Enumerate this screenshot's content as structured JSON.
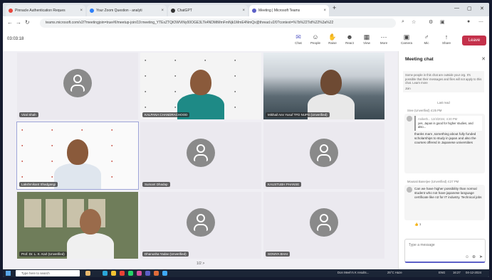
{
  "browser": {
    "tabs": [
      {
        "label": "Pinnacle Authentication Reques",
        "color": "#e8453c",
        "active": false
      },
      {
        "label": "Your Zoom Question - analyti",
        "color": "#2d7ff9",
        "active": false
      },
      {
        "label": "ChatGPT",
        "color": "#333333",
        "active": false
      },
      {
        "label": "Meeting | Microsoft Teams",
        "color": "#5b5fc7",
        "active": true
      }
    ],
    "new_tab": "+",
    "url": "teams.microsoft.com/v2/?meetingjoin=true#/l/meetup-join/19:meeting_YTExZTQtOWViNy00OGE3LTk4NDMtMmFmNjk1MmE4NmQx@thread.v2/0?context=%7b%22Tid%22%3a%22"
  },
  "teams": {
    "timer": "03:03:18",
    "toolbar": [
      {
        "label": "Chat",
        "glyph": "✉",
        "active": true
      },
      {
        "label": "People",
        "glyph": "☺",
        "active": false
      },
      {
        "label": "Raise",
        "glyph": "✋",
        "active": false
      },
      {
        "label": "React",
        "glyph": "☻",
        "active": false
      },
      {
        "label": "View",
        "glyph": "▦",
        "active": false
      },
      {
        "label": "More",
        "glyph": "⋯",
        "active": false
      },
      {
        "label": "Camera",
        "glyph": "▣",
        "active": false
      },
      {
        "label": "Mic",
        "glyph": "♂",
        "active": false
      },
      {
        "label": "Share",
        "glyph": "↑",
        "active": false
      }
    ],
    "leave_label": "Leave"
  },
  "participants": [
    {
      "name": "Viral Shah",
      "kind": "avatar"
    },
    {
      "name": "KALPANA CHANDRACHOOD",
      "kind": "woman"
    },
    {
      "name": "Mikhail Ann Yusuf TFD NUPS (Unverified)",
      "kind": "mountain"
    },
    {
      "name": "Lakshmikant Shadgangi",
      "kind": "man"
    },
    {
      "name": "Sumant Dhadap",
      "kind": "avatar"
    },
    {
      "name": "KAUSTUBH PHANSE",
      "kind": "avatar"
    },
    {
      "name": "Prof. Dr. L. K. Karl (Unverified)",
      "kind": "office"
    },
    {
      "name": "Dhanusha Yadav (Unverified)",
      "kind": "avatar"
    },
    {
      "name": "SONIYA BHAI",
      "kind": "avatar"
    }
  ],
  "pager": "1/2 >",
  "chat": {
    "title": "Meeting chat",
    "notice": "Some people in this chat are outside your org. It's possible that their messages and files will not apply to this chat. Learn more",
    "notice_extra": "Join",
    "last_read": "Last read",
    "messages": [
      {
        "meta": "Sree (Unverified) 4:25 PM",
        "quote_meta": "Aniketh... 12/4/2024, 4:20 PM",
        "quote": "yes, Japan is good for higher studies, and also...",
        "text": "thanks mam ,something about fully funded scholarships to study in japan and also the courses offered in Japanese universities"
      },
      {
        "meta": "Mousati Banerjee (Unverified) 4:27 PM",
        "text": "Can we have higher possibility than normal student who not have japanese language certificate like n3 for IT industry. Technical jobs",
        "reaction": "👍 1"
      }
    ],
    "compose_placeholder": "Type a message"
  },
  "taskbar": {
    "search_placeholder": "Type here to search",
    "news": "Don Meeh's K results...",
    "lang": "ENG",
    "time": "16:27",
    "date": "04-12-2024",
    "temp": "25°C Haze"
  }
}
